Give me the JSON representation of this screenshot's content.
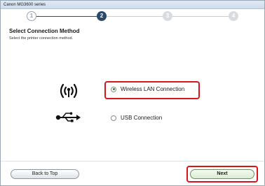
{
  "window": {
    "title": "Canon MG3600 series"
  },
  "steps": [
    {
      "label": "1",
      "state": "done"
    },
    {
      "label": "2",
      "state": "current"
    },
    {
      "label": "3",
      "state": "todo"
    },
    {
      "label": "4",
      "state": "todo"
    }
  ],
  "page": {
    "heading": "Select Connection Method",
    "subheading": "Select the printer connection method."
  },
  "options": {
    "wireless": {
      "label": "Wireless LAN Connection",
      "selected": true,
      "icon": "wifi-icon"
    },
    "usb": {
      "label": "USB Connection",
      "selected": false,
      "icon": "usb-icon"
    }
  },
  "buttons": {
    "back_label": "Back to Top",
    "next_label": "Next"
  },
  "colors": {
    "highlight": "#d8141c",
    "step_current": "#2c4a6d",
    "radio_selected": "#2a8a3a"
  }
}
